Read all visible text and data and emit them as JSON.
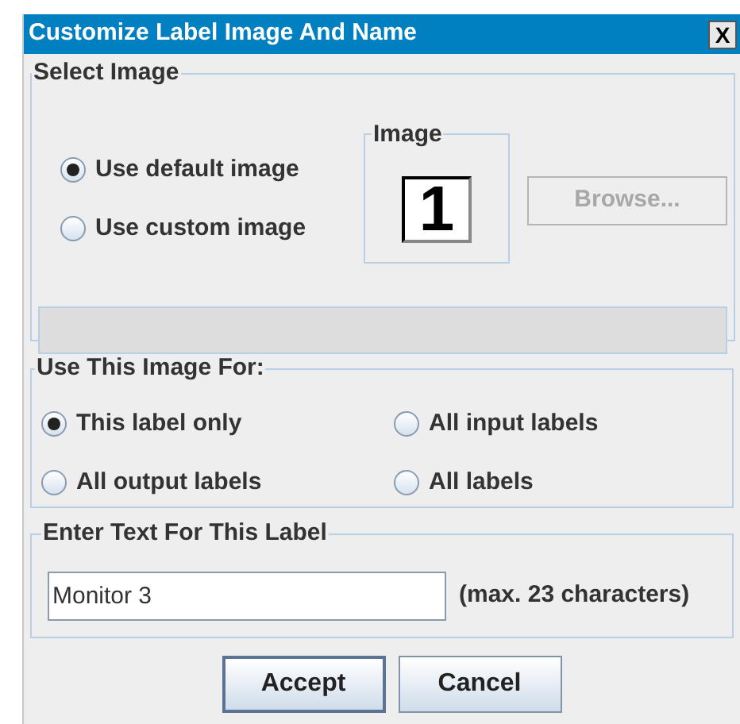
{
  "window": {
    "title": "Customize Label Image And Name",
    "close": "X"
  },
  "select_image": {
    "title": "Select Image",
    "options": [
      {
        "label": "Use default image",
        "selected": true
      },
      {
        "label": "Use custom image",
        "selected": false
      }
    ],
    "image_box": {
      "title": "Image",
      "glyph": "1"
    },
    "browse_button": {
      "label": "Browse...",
      "disabled": true
    }
  },
  "use_for": {
    "title": "Use This Image For:",
    "options": [
      {
        "label": "This label only",
        "selected": true
      },
      {
        "label": "All input labels",
        "selected": false
      },
      {
        "label": "All output labels",
        "selected": false
      },
      {
        "label": "All labels",
        "selected": false
      }
    ]
  },
  "label_text": {
    "title": "Enter Text For This Label",
    "value": "Monitor 3",
    "hint": "(max. 23 characters)"
  },
  "buttons": [
    {
      "label": "Accept",
      "focused": true
    },
    {
      "label": "Cancel",
      "focused": false
    }
  ]
}
